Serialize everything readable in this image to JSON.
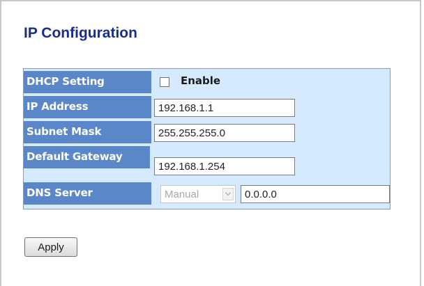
{
  "page": {
    "title": "IP Configuration"
  },
  "form": {
    "dhcp": {
      "label": "DHCP Setting",
      "checkbox_label": "Enable",
      "checked": false
    },
    "ip_address": {
      "label": "IP Address",
      "value": "192.168.1.1"
    },
    "subnet_mask": {
      "label": "Subnet Mask",
      "value": "255.255.255.0"
    },
    "default_gateway": {
      "label": "Default Gateway",
      "value": "192.168.1.254"
    },
    "dns_server": {
      "label": "DNS Server",
      "mode_selected": "Manual",
      "mode_disabled": true,
      "value": "0.0.0.0"
    }
  },
  "actions": {
    "apply_label": "Apply"
  },
  "colors": {
    "title": "#1a2d8f",
    "label_background": "#5b86c8",
    "table_background": "#d6eaff"
  }
}
